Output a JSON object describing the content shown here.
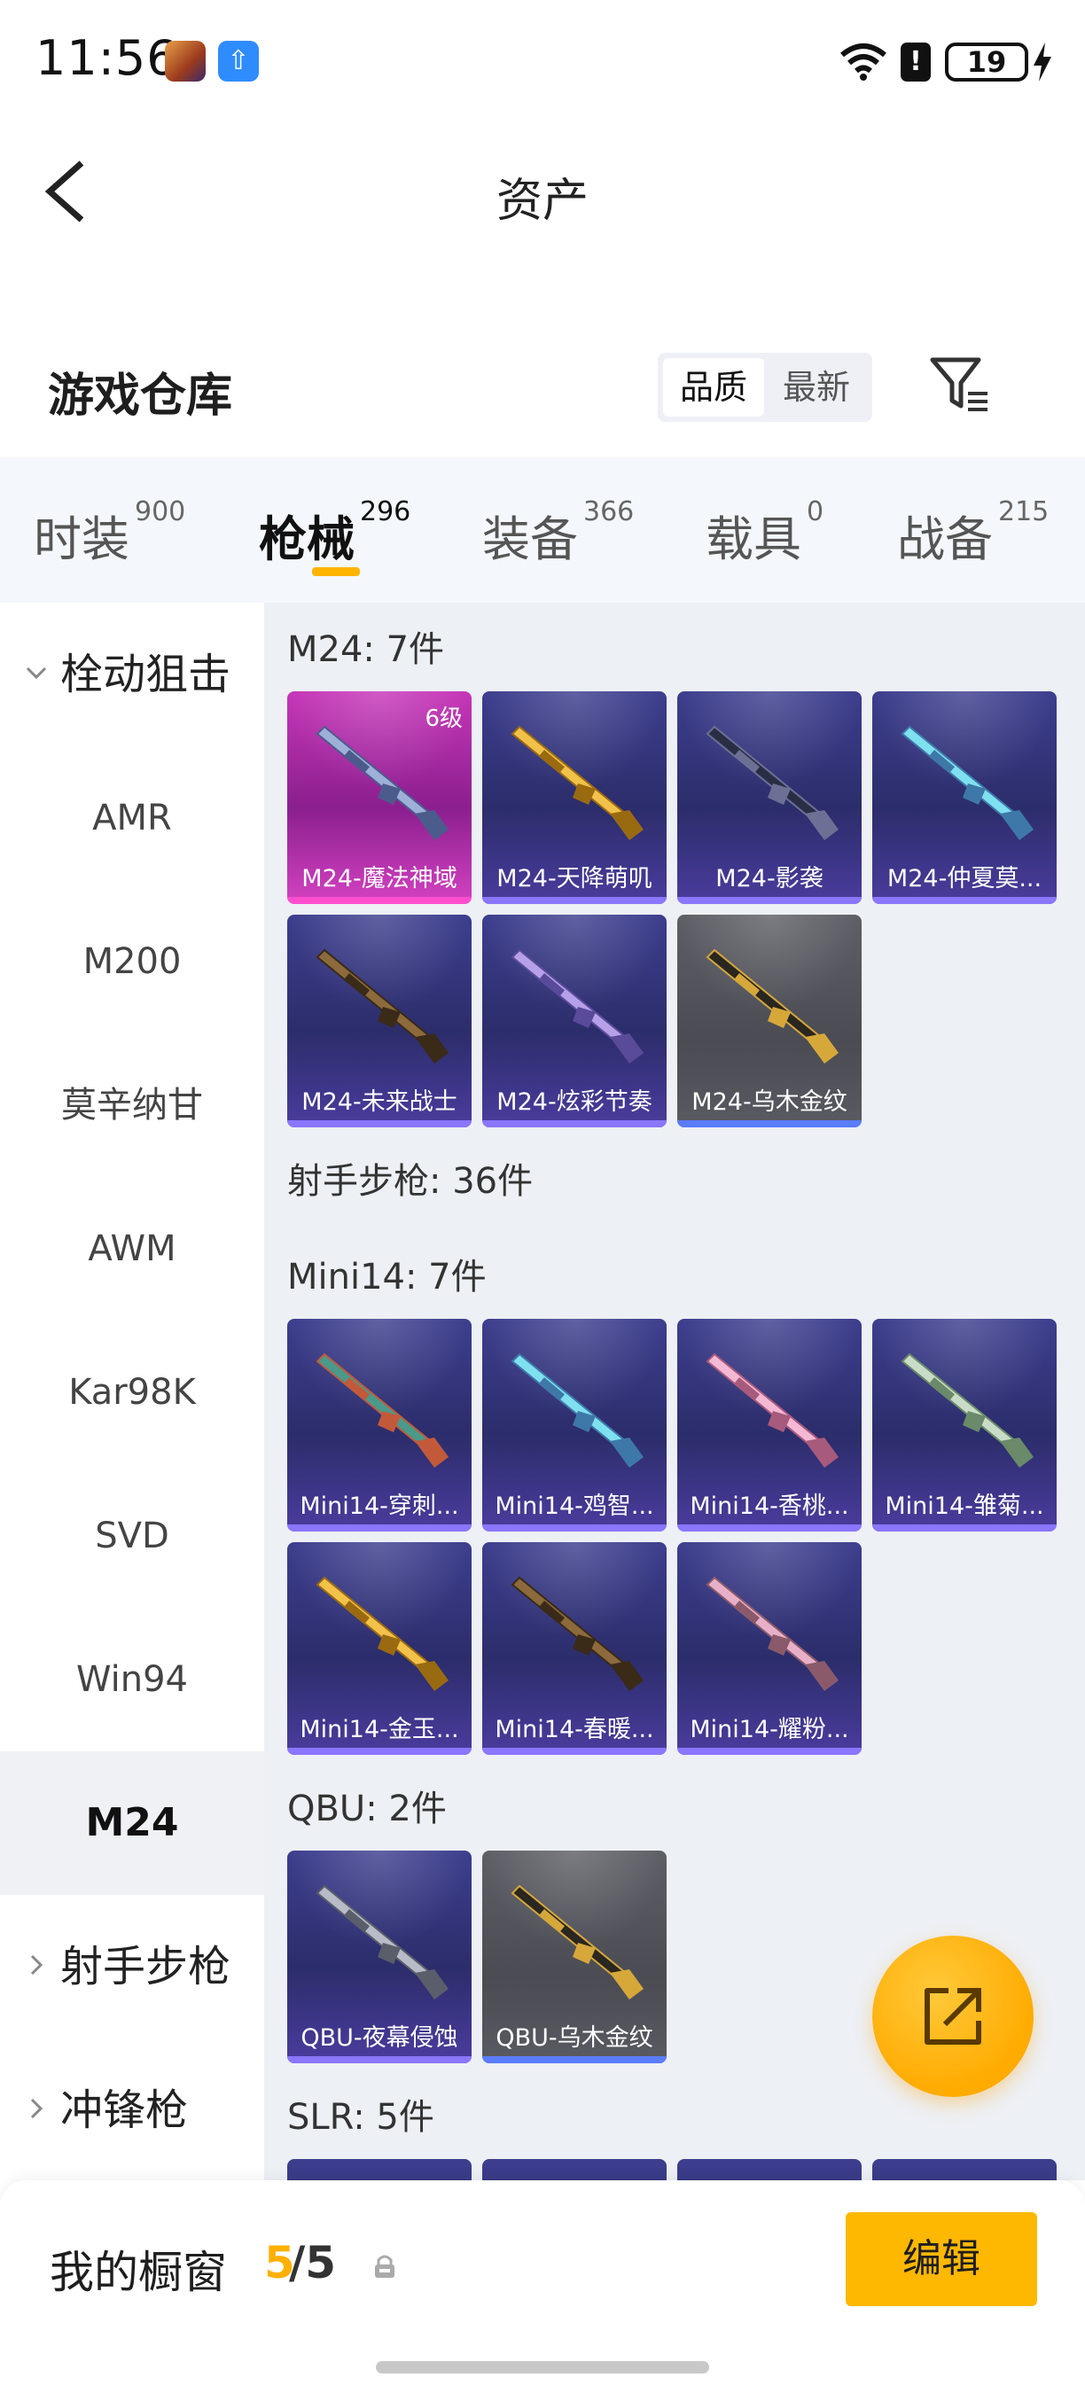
{
  "status_bar": {
    "time": "11:56",
    "battery": "19"
  },
  "header": {
    "title": "资产"
  },
  "warehouse": {
    "title": "游戏仓库",
    "sort_quality": "品质",
    "sort_newest": "最新"
  },
  "tabs": [
    {
      "label": "时装",
      "count": "900"
    },
    {
      "label": "枪械",
      "count": "296"
    },
    {
      "label": "装备",
      "count": "366"
    },
    {
      "label": "载具",
      "count": "0"
    },
    {
      "label": "战备",
      "count": "215"
    }
  ],
  "categories": [
    {
      "label": "栓动狙击",
      "type": "group-open"
    },
    {
      "label": "AMR"
    },
    {
      "label": "M200"
    },
    {
      "label": "莫辛纳甘"
    },
    {
      "label": "AWM"
    },
    {
      "label": "Kar98K"
    },
    {
      "label": "SVD"
    },
    {
      "label": "Win94"
    },
    {
      "label": "M24",
      "selected": true
    },
    {
      "label": "射手步枪",
      "type": "group-closed"
    },
    {
      "label": "冲锋枪",
      "type": "group-closed"
    }
  ],
  "sections": {
    "m24": {
      "title": "M24: 7件",
      "items": [
        {
          "name": "M24-魔法神域",
          "level": "6级",
          "rarity": "pink",
          "gun": "blue"
        },
        {
          "name": "M24-天降萌叽",
          "rarity": "purple",
          "gun": "gold"
        },
        {
          "name": "M24-影袭",
          "rarity": "purple",
          "gun": "dark"
        },
        {
          "name": "M24-仲夏莫...",
          "rarity": "purple",
          "gun": "cyan"
        },
        {
          "name": "M24-未来战士",
          "rarity": "purple",
          "gun": "bronze"
        },
        {
          "name": "M24-炫彩节奏",
          "rarity": "purple",
          "gun": "violet"
        },
        {
          "name": "M24-乌木金纹",
          "rarity": "grey",
          "gun": "black-gold"
        }
      ]
    },
    "marksman": {
      "title": "射手步枪: 36件"
    },
    "mini14": {
      "title": "Mini14: 7件",
      "items": [
        {
          "name": "Mini14-穿刺...",
          "rarity": "purple",
          "gun": "teal"
        },
        {
          "name": "Mini14-鸡智...",
          "rarity": "purple",
          "gun": "cyan"
        },
        {
          "name": "Mini14-香桃...",
          "rarity": "purple",
          "gun": "pink"
        },
        {
          "name": "Mini14-雏菊...",
          "rarity": "purple",
          "gun": "mint"
        },
        {
          "name": "Mini14-金玉...",
          "rarity": "purple",
          "gun": "gold"
        },
        {
          "name": "Mini14-春暖...",
          "rarity": "purple",
          "gun": "bronze"
        },
        {
          "name": "Mini14-耀粉...",
          "rarity": "purple",
          "gun": "rose"
        }
      ]
    },
    "qbu": {
      "title": "QBU: 2件",
      "items": [
        {
          "name": "QBU-夜幕侵蚀",
          "rarity": "purple",
          "gun": "silver"
        },
        {
          "name": "QBU-乌木金纹",
          "rarity": "grey",
          "gun": "black-gold"
        }
      ]
    },
    "slr": {
      "title": "SLR: 5件"
    }
  },
  "showcase": {
    "label": "我的橱窗",
    "current": "5",
    "total": "/5",
    "edit_label": "编辑"
  },
  "colors": {
    "accent": "#FFB800",
    "pink_rarity": "#C636B8",
    "purple_rarity": "#3D3E8E",
    "grey_rarity": "#5E5F66"
  },
  "icons": [
    "back-arrow-icon",
    "filter-icon",
    "share-icon",
    "lock-icon",
    "chevron-down-icon",
    "chevron-right-icon",
    "wifi-icon",
    "battery-icon"
  ]
}
